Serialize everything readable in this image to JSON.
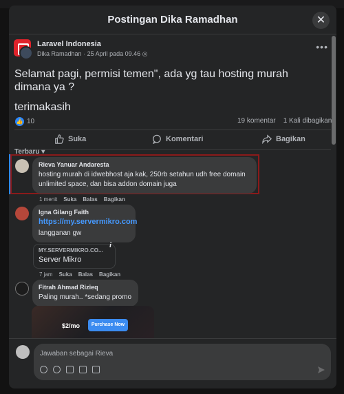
{
  "modal": {
    "title": "Postingan Dika Ramadhan",
    "close_label": "✕"
  },
  "post": {
    "group_name": "Laravel Indonesia",
    "author": "Dika Ramadhan",
    "date": "25 April pada 09.46",
    "text_line1": "Selamat pagi, permisi temen\", ada yg tau hosting murah dimana ya ?",
    "text_line2": "terimakasih",
    "likes": "10",
    "comments_count": "19 komentar",
    "shares_count": "1 Kali dibagikan"
  },
  "actions": {
    "like": "Suka",
    "comment": "Komentari",
    "share": "Bagikan"
  },
  "sort_label": "Terbaru",
  "comments": [
    {
      "name": "Rieva Yanuar Andaresta",
      "text": "hosting murah di idwebhost aja kak, 250rb setahun udh free domain unlimited space, dan bisa addon domain juga",
      "time": "1 menit",
      "like": "Suka",
      "reply": "Balas",
      "share": "Bagikan"
    },
    {
      "name": "Igna Gilang Faith",
      "link": "https://my.servermikro.com",
      "text": "langganan gw",
      "card_domain": "MY.SERVERMIKRO.CO...",
      "card_title": "Server Mikro",
      "time": "7 jam",
      "like": "Suka",
      "reply": "Balas",
      "share": "Bagikan"
    },
    {
      "name": "Fitrah Ahmad Rizieq",
      "text": "Paling murah.. *sedang promo",
      "media_price": "$2/mo",
      "media_button": "Purchase Now"
    }
  ],
  "composer": {
    "placeholder": "Jawaban sebagai Rieva"
  },
  "colors": {
    "accent": "#2d88ff",
    "link": "#4599ff",
    "highlight_border": "#8b1a1a",
    "group_brand": "#e0232b"
  }
}
